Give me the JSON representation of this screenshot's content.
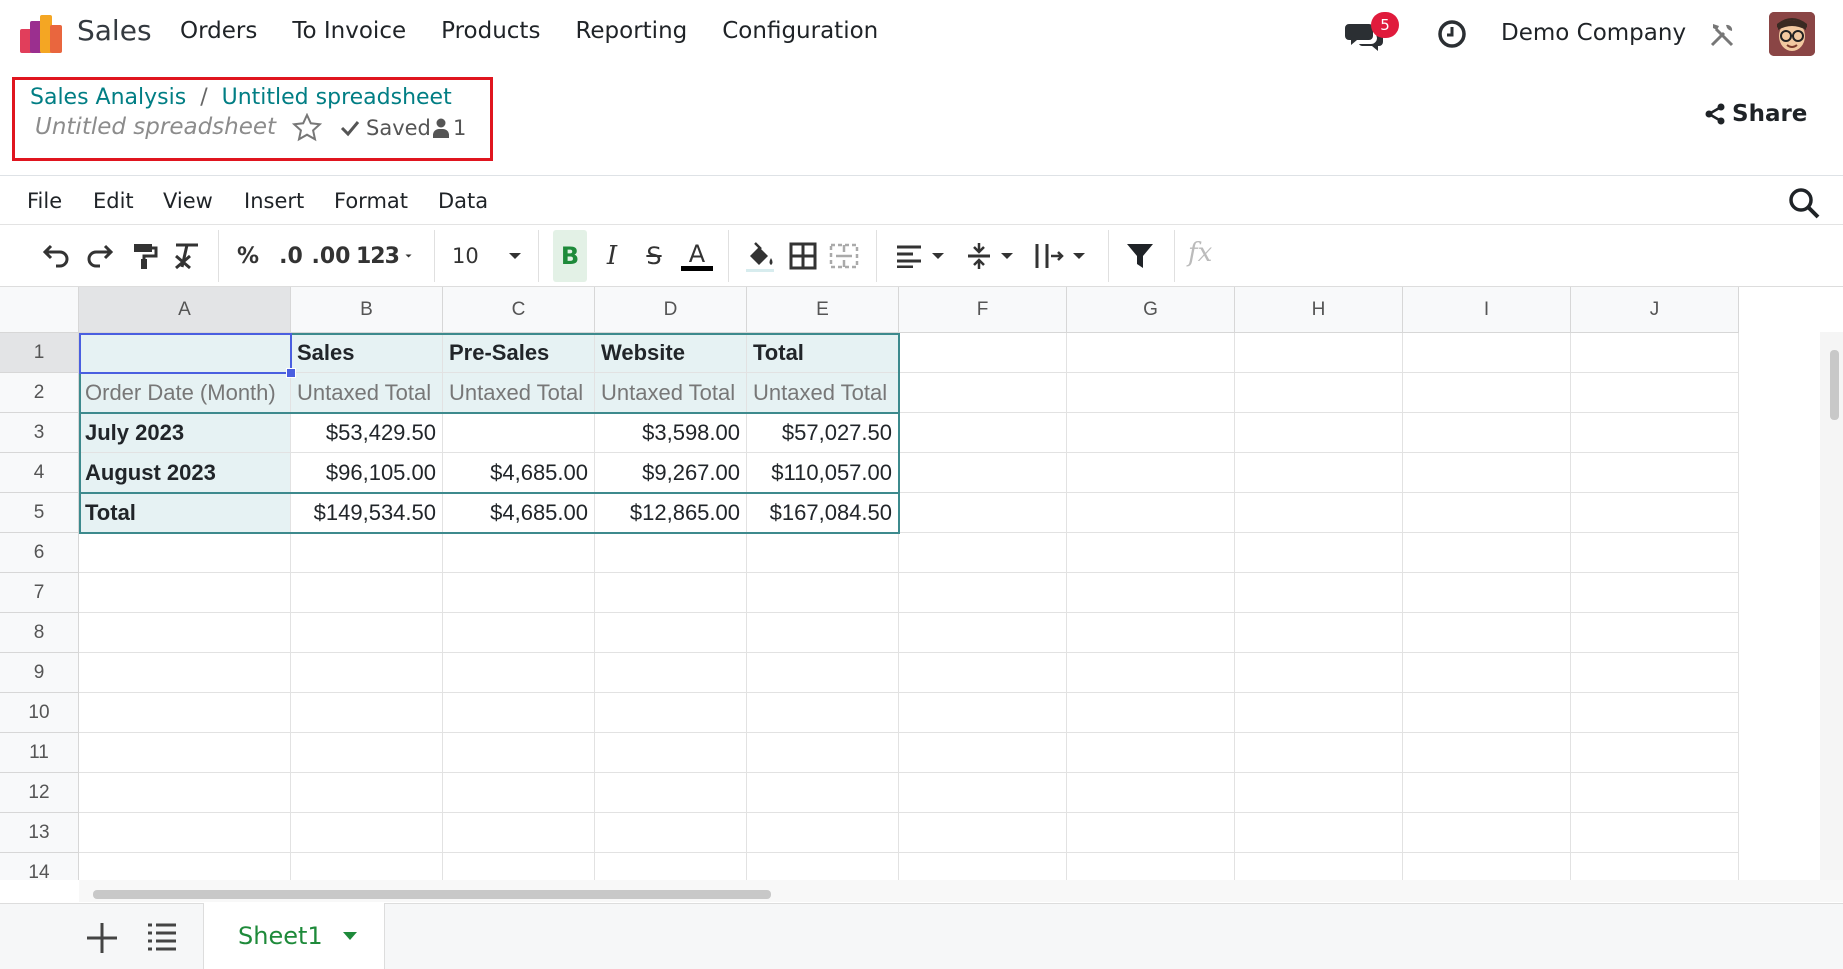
{
  "navbar": {
    "app_name": "Sales",
    "menu": [
      "Orders",
      "To Invoice",
      "Products",
      "Reporting",
      "Configuration"
    ],
    "notification_count": "5",
    "company": "Demo Company"
  },
  "control_panel": {
    "breadcrumb_parent": "Sales Analysis",
    "breadcrumb_separator": "/",
    "breadcrumb_current": "Untitled spreadsheet",
    "doc_title": "Untitled spreadsheet",
    "saved_label": "Saved",
    "users_count": "1",
    "share_label": "Share"
  },
  "menubar": [
    "File",
    "Edit",
    "View",
    "Insert",
    "Format",
    "Data"
  ],
  "toolbar": {
    "percent": "%",
    "dec_decrease": ".0",
    "dec_increase": ".00",
    "more_formats": "123",
    "font_size": "10",
    "bold": "B",
    "italic": "I",
    "strike": "S",
    "text_color": "A",
    "fx": "fx",
    "text_color_value": "#000000",
    "bold_active_color": "#1e8a3a"
  },
  "grid": {
    "columns": [
      "A",
      "B",
      "C",
      "D",
      "E",
      "F",
      "G",
      "H",
      "I",
      "J"
    ],
    "rows": [
      "1",
      "2",
      "3",
      "4",
      "5",
      "6",
      "7",
      "8",
      "9",
      "10",
      "11",
      "12",
      "13",
      "14"
    ],
    "cells": {
      "B1": "Sales",
      "C1": "Pre-Sales",
      "D1": "Website",
      "E1": "Total",
      "A2": "Order Date (Month)",
      "B2": "Untaxed Total",
      "C2": "Untaxed Total",
      "D2": "Untaxed Total",
      "E2": "Untaxed Total",
      "A3": "July 2023",
      "B3": "$53,429.50",
      "C3": "",
      "D3": "$3,598.00",
      "E3": "$57,027.50",
      "A4": "August 2023",
      "B4": "$96,105.00",
      "C4": "$4,685.00",
      "D4": "$9,267.00",
      "E4": "$110,057.00",
      "A5": "Total",
      "B5": "$149,534.50",
      "C5": "$4,685.00",
      "D5": "$12,865.00",
      "E5": "$167,084.50"
    },
    "selected_cell": "A1",
    "pivot_color": "#e6f2f3",
    "pivot_border_color": "#3d8a8d",
    "selection_color": "#4a5fe0"
  },
  "sheets": {
    "active_name": "Sheet1"
  }
}
